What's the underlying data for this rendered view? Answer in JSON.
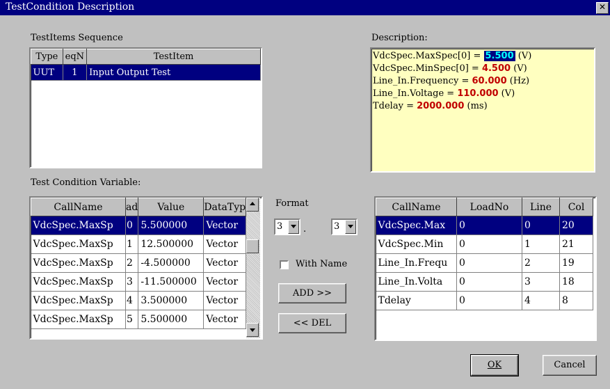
{
  "window": {
    "title": "TestCondition Description",
    "close_glyph": "✕"
  },
  "sequence": {
    "label": "TestItems Sequence",
    "columns": [
      "Type",
      "eqN",
      "TestItem"
    ],
    "rows": [
      [
        "UUT",
        "1",
        "Input Output Test"
      ]
    ]
  },
  "description": {
    "label": "Description:",
    "lines": [
      {
        "prefix": "VdcSpec.MaxSpec[0] = ",
        "value": "5.500",
        "suffix": " (V)",
        "highlight": true
      },
      {
        "prefix": "VdcSpec.MinSpec[0] = ",
        "value": "4.500",
        "suffix": " (V)",
        "highlight": false
      },
      {
        "prefix": "Line_In.Frequency = ",
        "value": "60.000",
        "suffix": " (Hz)",
        "highlight": false
      },
      {
        "prefix": "Line_In.Voltage = ",
        "value": "110.000",
        "suffix": " (V)",
        "highlight": false
      },
      {
        "prefix": "Tdelay = ",
        "value": "2000.000",
        "suffix": " (ms)",
        "highlight": false
      }
    ]
  },
  "variables": {
    "label": "Test Condition Variable:",
    "columns": [
      "CallName",
      "ad",
      "Value",
      "DataTyp"
    ],
    "rows": [
      [
        "VdcSpec.MaxSp",
        "0",
        "5.500000",
        "Vector"
      ],
      [
        "VdcSpec.MaxSp",
        "1",
        "12.500000",
        "Vector"
      ],
      [
        "VdcSpec.MaxSp",
        "2",
        "-4.500000",
        "Vector"
      ],
      [
        "VdcSpec.MaxSp",
        "3",
        "-11.500000",
        "Vector"
      ],
      [
        "VdcSpec.MaxSp",
        "4",
        "3.500000",
        "Vector"
      ],
      [
        "VdcSpec.MaxSp",
        "5",
        "5.500000",
        "Vector"
      ]
    ]
  },
  "format": {
    "label": "Format",
    "value1": "3",
    "separator": ".",
    "value2": "3"
  },
  "with_name": {
    "label": "With Name",
    "checked": false
  },
  "buttons": {
    "add": "ADD  >>",
    "del": "<<  DEL",
    "ok": "OK",
    "cancel": "Cancel"
  },
  "selected": {
    "columns": [
      "CallName",
      "LoadNo",
      "Line",
      "Col"
    ],
    "rows": [
      [
        "VdcSpec.Max",
        "0",
        "0",
        "20"
      ],
      [
        "VdcSpec.Min",
        "0",
        "1",
        "21"
      ],
      [
        "Line_In.Frequ",
        "0",
        "2",
        "19"
      ],
      [
        "Line_In.Volta",
        "0",
        "3",
        "18"
      ],
      [
        "Tdelay",
        "0",
        "4",
        "8"
      ]
    ]
  },
  "icons": {
    "close": "close-icon",
    "dropdown": "chevron-down-icon",
    "scroll_up": "arrow-up-icon",
    "scroll_down": "arrow-down-icon"
  }
}
